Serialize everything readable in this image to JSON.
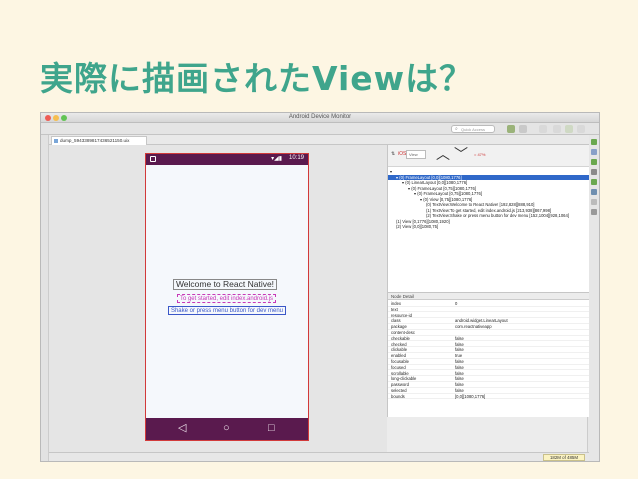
{
  "slide": {
    "title": "実際に描画されたViewは？"
  },
  "window": {
    "title": "Android Device Monitor",
    "quick_access_placeholder": "Quick Access",
    "tab_label": "dump_5943389817436521150.uix",
    "memory": "182M of 485M"
  },
  "device": {
    "status_time": "10:19",
    "status_icons": "▾◢▮",
    "welcome_text": "Welcome to React Native!",
    "instruction_1": "To get started, edit index.android.js",
    "instruction_2": "Shake or press menu button for dev menu",
    "nav_back": "◁",
    "nav_home": "○",
    "nav_recent": "□"
  },
  "hierarchy": {
    "filter_label": "iOS",
    "nav_up": "︿",
    "nav_down": "﹀",
    "filter_value": "View",
    "misc_text": "= 47%",
    "rows": [
      {
        "indent": 0,
        "text": "▾",
        "selected": false
      },
      {
        "indent": 1,
        "text": "▾ (0) FrameLayout [0,0][1080,1776]",
        "selected": false
      },
      {
        "indent": 2,
        "text": "▾ (0) LinearLayout [0,0][1080,1776]",
        "selected": false
      },
      {
        "indent": 3,
        "text": "▾ (0) FrameLayout [0,75][1080,1776]",
        "selected": false
      },
      {
        "indent": 4,
        "text": "▾ (0) FrameLayout [0,75][1080,1776]",
        "selected": false
      },
      {
        "indent": 5,
        "text": "▾ (0) View [0,75][1080,1776]",
        "selected": false
      },
      {
        "indent": 6,
        "text": "(0) TextView:Welcome to React Native! [192,828][888,910]",
        "selected": false
      },
      {
        "indent": 6,
        "text": "(1) TextView:To get started, edit index.android.js [213,938][867,998]",
        "selected": false
      },
      {
        "indent": 6,
        "text": "(2) TextView:Shake or press menu button for dev menu [152,1004][928,1064]",
        "selected": false
      },
      {
        "indent": 1,
        "text": "(1) View [0,1776][1080,1920]",
        "selected": false
      },
      {
        "indent": 1,
        "text": "(2) View [0,0][1080,75]",
        "selected": false
      }
    ]
  },
  "node_detail": {
    "header": "Node Detail",
    "rows": [
      {
        "key": "index",
        "value": "0"
      },
      {
        "key": "text",
        "value": ""
      },
      {
        "key": "resource-id",
        "value": ""
      },
      {
        "key": "class",
        "value": "android.widget.LinearLayout"
      },
      {
        "key": "package",
        "value": "com.reactnativeapp"
      },
      {
        "key": "content-desc",
        "value": ""
      },
      {
        "key": "checkable",
        "value": "false"
      },
      {
        "key": "checked",
        "value": "false"
      },
      {
        "key": "clickable",
        "value": "false"
      },
      {
        "key": "enabled",
        "value": "true"
      },
      {
        "key": "focusable",
        "value": "false"
      },
      {
        "key": "focused",
        "value": "false"
      },
      {
        "key": "scrollable",
        "value": "false"
      },
      {
        "key": "long-clickable",
        "value": "false"
      },
      {
        "key": "password",
        "value": "false"
      },
      {
        "key": "selected",
        "value": "false"
      },
      {
        "key": "bounds",
        "value": "[0,0][1080,1776]"
      }
    ]
  }
}
